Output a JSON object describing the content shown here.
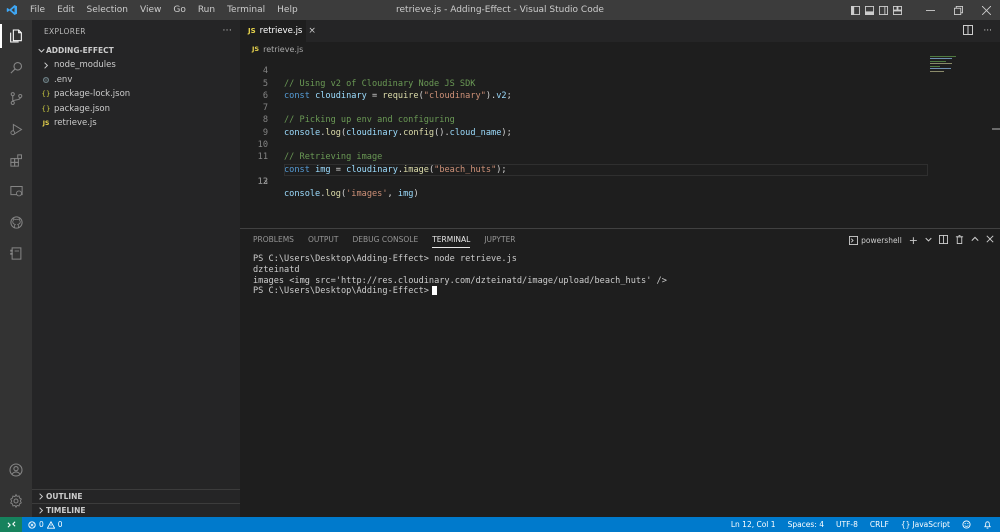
{
  "titlebar": {
    "menu": [
      "File",
      "Edit",
      "Selection",
      "View",
      "Go",
      "Run",
      "Terminal",
      "Help"
    ],
    "title": "retrieve.js - Adding-Effect - Visual Studio Code"
  },
  "sidebar": {
    "header": "EXPLORER",
    "more": "···",
    "folder": "ADDING-EFFECT",
    "items": [
      {
        "label": "node_modules",
        "icon": "chevron-right-icon"
      },
      {
        "label": ".env",
        "icon": "gear-icon"
      },
      {
        "label": "package-lock.json",
        "icon": "{}"
      },
      {
        "label": "package.json",
        "icon": "{}"
      },
      {
        "label": "retrieve.js",
        "icon": "JS"
      }
    ],
    "outline": "OUTLINE",
    "timeline": "TIMELINE"
  },
  "editor": {
    "tab": {
      "badge": "JS",
      "label": "retrieve.js"
    },
    "breadcrumb": {
      "badge": "JS",
      "label": "retrieve.js"
    },
    "lines": [
      {
        "n": "4",
        "text": "// Using v2 of Cloudinary Node JS SDK"
      },
      {
        "n": "5",
        "text": "const cloudinary = require(\"cloudinary\").v2;"
      },
      {
        "n": "6",
        "text": ""
      },
      {
        "n": "7",
        "text": "// Picking up env and configuring"
      },
      {
        "n": "8",
        "text": "console.log(cloudinary.config().cloud_name);"
      },
      {
        "n": "9",
        "text": ""
      },
      {
        "n": "10",
        "text": "// Retrieving image"
      },
      {
        "n": "11",
        "text": "const img = cloudinary.image(\"beach_huts\");"
      },
      {
        "n": "12",
        "text": ""
      },
      {
        "n": "13",
        "text": "console.log('images', img)"
      }
    ]
  },
  "panel": {
    "tabs": [
      "PROBLEMS",
      "OUTPUT",
      "DEBUG CONSOLE",
      "TERMINAL",
      "JUPYTER"
    ],
    "active_tab": "TERMINAL",
    "shell": "powershell",
    "terminal": [
      "PS C:\\Users\\Desktop\\Adding-Effect> node retrieve.js",
      "dzteinatd",
      "images <img src='http://res.cloudinary.com/dzteinatd/image/upload/beach_huts' />",
      "PS C:\\Users\\Desktop\\Adding-Effect>"
    ]
  },
  "statusbar": {
    "errors": "0",
    "warnings": "0",
    "position": "Ln 12, Col 1",
    "spaces": "Spaces: 4",
    "encoding": "UTF-8",
    "eol": "CRLF",
    "language": "JavaScript"
  },
  "colors": {
    "statusbar": "#007acc",
    "remote": "#16825d",
    "titlebar": "#3c3c3c",
    "activitybar": "#333333",
    "sidebar": "#252526",
    "editor": "#1e1e1e"
  }
}
